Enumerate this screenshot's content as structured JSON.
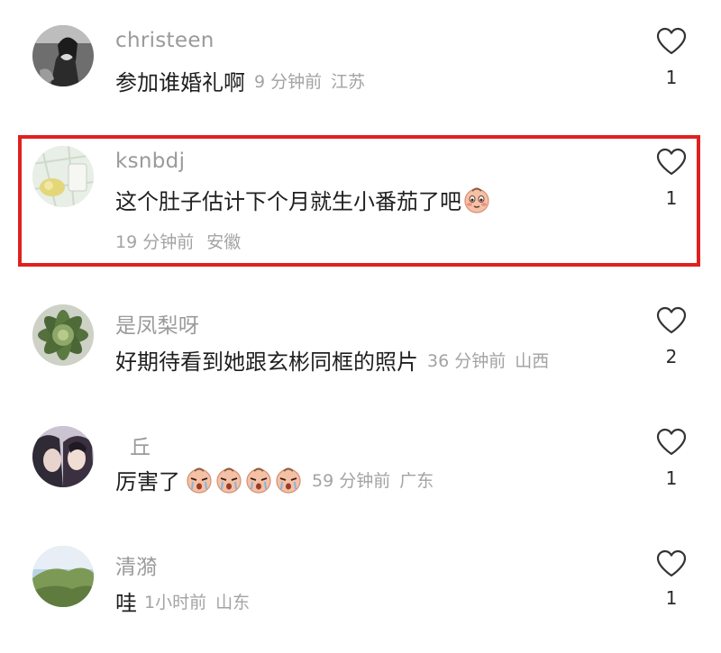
{
  "comments": [
    {
      "username": "christeen",
      "text": "参加谁婚礼啊",
      "time": "9 分钟前",
      "location": "江苏",
      "likes": "1",
      "avatar_icon": "bw-portrait-avatar"
    },
    {
      "username": "ksnbdj",
      "text": "这个肚子估计下个月就生小番茄了吧",
      "time": "19 分钟前",
      "location": "安徽",
      "likes": "1",
      "emoji_count": 1,
      "avatar_icon": "map-avatar"
    },
    {
      "username": "是凤梨呀",
      "text": "好期待看到她跟玄彬同框的照片",
      "time": "36 分钟前",
      "location": "山西",
      "likes": "2",
      "avatar_icon": "succulent-avatar"
    },
    {
      "username": "丘",
      "text": "厉害了",
      "time": "59 分钟前",
      "location": "广东",
      "likes": "1",
      "emoji_count": 4,
      "avatar_icon": "selfie-avatar"
    },
    {
      "username": "清漪",
      "text": "哇",
      "time": "1小时前",
      "location": "山东",
      "likes": "1",
      "avatar_icon": "landscape-avatar"
    }
  ],
  "colors": {
    "highlight": "#e02020",
    "username": "#9a9a9a",
    "meta": "#a3a3a3",
    "text": "#1f1f1f"
  }
}
